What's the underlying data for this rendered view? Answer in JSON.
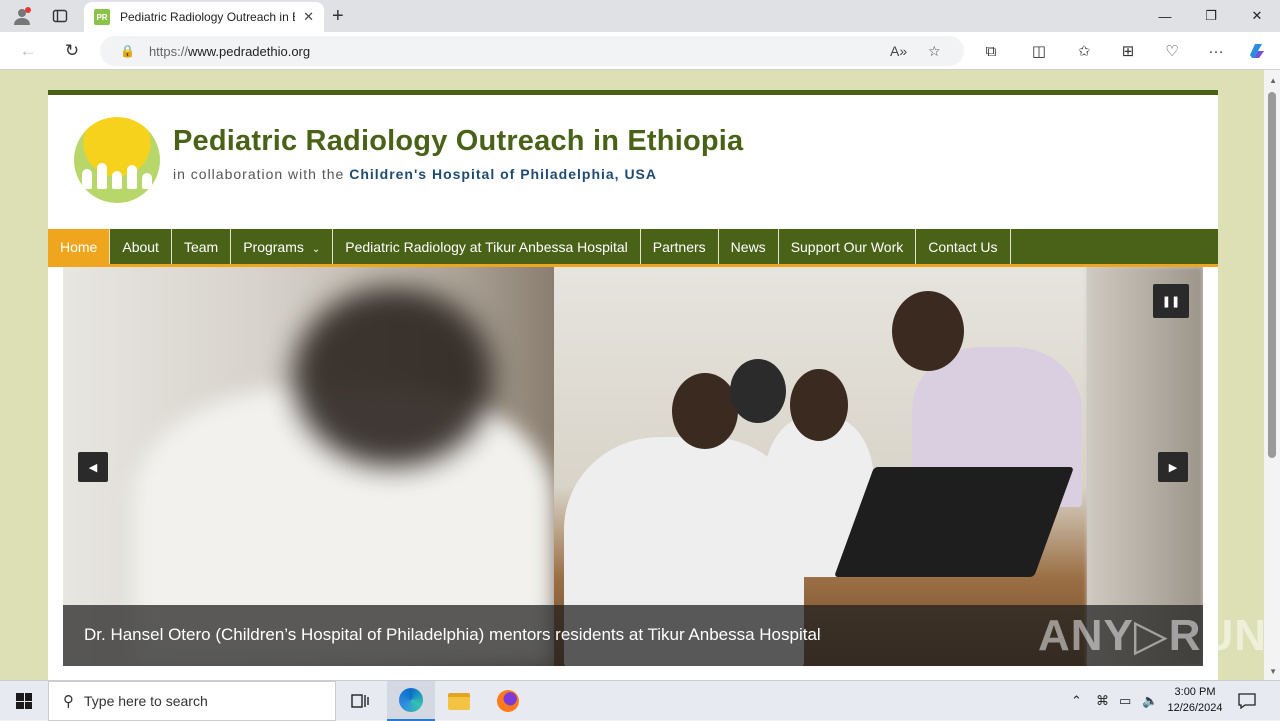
{
  "browser": {
    "tab_title": "Pediatric Radiology Outreach in E",
    "favicon_text": "PR",
    "url_prefix": "https://",
    "url_domain": "www.pedradethio.org"
  },
  "site": {
    "title": "Pediatric Radiology Outreach in Ethiopia",
    "subtitle_prefix": "in collaboration with the ",
    "subtitle_highlight": "Children's Hospital of Philadelphia, USA"
  },
  "menu": {
    "items": [
      {
        "label": "Home"
      },
      {
        "label": "About"
      },
      {
        "label": "Team"
      },
      {
        "label": "Programs"
      },
      {
        "label": "Pediatric Radiology at Tikur Anbessa Hospital"
      },
      {
        "label": "Partners"
      },
      {
        "label": "News"
      },
      {
        "label": "Support Our Work"
      },
      {
        "label": "Contact Us"
      }
    ]
  },
  "slider": {
    "caption": "Dr. Hansel Otero (Children’s Hospital of Philadelphia) mentors residents at Tikur Anbessa Hospital"
  },
  "watermark": "ANY▷RUN",
  "taskbar": {
    "search_placeholder": "Type here to search",
    "time": "3:00 PM",
    "date": "12/26/2024"
  },
  "colors": {
    "brand_green": "#4a6218",
    "accent_orange": "#f0a51e",
    "page_bg": "#dde0b5"
  }
}
